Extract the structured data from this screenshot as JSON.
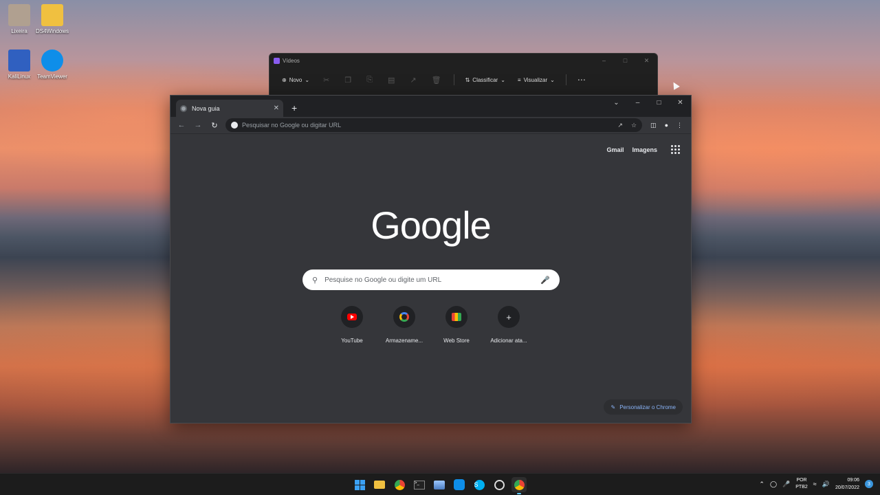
{
  "desktop": {
    "icons": [
      {
        "label": "Lixeira",
        "icon": "recycle-bin-icon",
        "color": "#b0a090"
      },
      {
        "label": "DS4Windows",
        "icon": "folder-icon",
        "color": "#f0c040"
      },
      {
        "label": "KaliLinux",
        "icon": "virtualbox-icon",
        "color": "#3060c0"
      },
      {
        "label": "TeamViewer",
        "icon": "teamviewer-icon",
        "color": "#0e8ee9"
      }
    ]
  },
  "explorer": {
    "title": "Vídeos",
    "new_label": "Novo",
    "sort_label": "Classificar",
    "view_label": "Visualizar"
  },
  "chrome": {
    "tab_title": "Nova guia",
    "omnibox_placeholder": "Pesquisar no Google ou digitar URL",
    "gmail": "Gmail",
    "images": "Imagens",
    "logo": "Google",
    "search_placeholder": "Pesquise no Google ou digite um URL",
    "shortcuts": [
      {
        "label": "YouTube",
        "icon": "youtube-icon"
      },
      {
        "label": "Armazename...",
        "icon": "google-icon"
      },
      {
        "label": "Web Store",
        "icon": "webstore-icon"
      },
      {
        "label": "Adicionar ata...",
        "icon": "plus-icon"
      }
    ],
    "customize": "Personalizar o Chrome"
  },
  "taskbar": {
    "lang_top": "POR",
    "lang_bottom": "PTB2",
    "time": "09:06",
    "date": "20/07/2022",
    "notifications": "3",
    "accent": "#60cdff"
  }
}
